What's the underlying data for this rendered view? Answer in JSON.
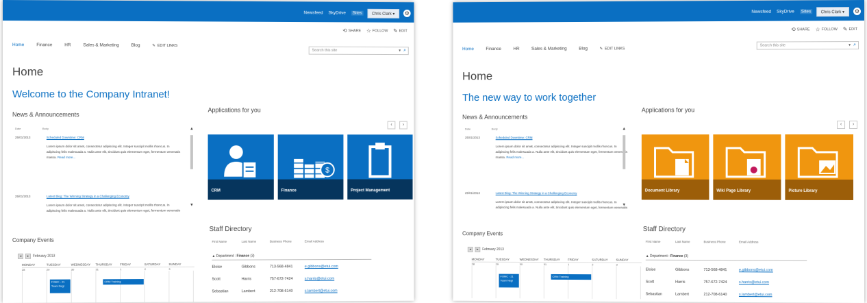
{
  "colors": {
    "accent": "#0a6fc2",
    "tile_blue": "#0a6fc2",
    "tile_blue_band": "#06355d",
    "tile_orange": "#f0960f",
    "tile_orange_band": "#9c5e09"
  },
  "suite": {
    "links": [
      "Newsfeed",
      "SkyDrive",
      "Sites"
    ],
    "user": "Chris Clark ▾"
  },
  "actions": {
    "share": "SHARE",
    "follow": "FOLLOW",
    "edit": "EDIT"
  },
  "nav": {
    "items": [
      "Home",
      "Finance",
      "HR",
      "Sales & Marketing",
      "Blog"
    ],
    "edit_links": "EDIT LINKS"
  },
  "search": {
    "placeholder": "Search this site"
  },
  "page_title": "Home",
  "news": {
    "heading": "News & Announcements",
    "col_date": "Date",
    "col_body": "Body",
    "items": [
      {
        "date": "25/01/2013",
        "title": "Scheduled Downtime: CRM",
        "body": "Lorem ipsum dolor sit amet, consectetur adipiscing elit. Integer suscipit mollis rhoncus. In adipiscing felis malesuada a. Nulla ante elit, tincidunt quis elementum eget, fermentum venenatis massa.",
        "more": "Read more..."
      },
      {
        "date": "25/01/2013",
        "title": "Latest Blog: The Winning Strategy in a Challenging Economy",
        "body": "Lorem ipsum dolor sit amet, consectetur adipiscing elit. Integer suscipit mollis rhoncus. In adipiscing felis malesuada a. Nulla ante elit, tincidunt quis elementum eget, fermentum venenatis",
        "more": ""
      }
    ]
  },
  "events": {
    "heading": "Company Events",
    "month": "February 2013",
    "days": [
      "MONDAY",
      "TUESDAY",
      "WEDNESDAY",
      "THURSDAY",
      "FRIDAY",
      "SATURDAY",
      "SUNDAY"
    ],
    "dates": [
      "28",
      "29",
      "30",
      "31",
      "1",
      "2",
      "3"
    ],
    "event_a": "FOMC - 21 Team Negl",
    "event_b": "CRM Training"
  },
  "apps": {
    "heading": "Applications for you",
    "prev": "‹",
    "next": "›"
  },
  "staff": {
    "heading": "Staff Directory",
    "cols": [
      "First Name",
      "Last Name",
      "Business Phone",
      "Email Address"
    ],
    "group_prefix": "▲ Department : ",
    "group_name": "Finance",
    "group_count": "(3)",
    "rows": [
      {
        "first": "Eloise",
        "last": "Gibbons",
        "phone": "713-568-4841",
        "email": "e.gibbons@etui.com"
      },
      {
        "first": "Scott",
        "last": "Harris",
        "phone": "757-672-7424",
        "email": "s.harris@etui.com"
      },
      {
        "first": "Sebastian",
        "last": "Lambert",
        "phone": "212-708-6140",
        "email": "s.lambert@etui.com"
      }
    ]
  },
  "shot1": {
    "welcome": "Welcome to the Company Intranet!",
    "tiles": [
      {
        "label": "CRM",
        "icon": "crm-user-icon"
      },
      {
        "label": "Finance",
        "icon": "coins-icon"
      },
      {
        "label": "Project Management",
        "icon": "clipboard-icon"
      }
    ]
  },
  "shot2": {
    "welcome": "The new way to work together",
    "tiles": [
      {
        "label": "Document Library",
        "icon": "folder-document-icon"
      },
      {
        "label": "Wiki Page Library",
        "icon": "folder-wiki-icon"
      },
      {
        "label": "Picture Library",
        "icon": "folder-picture-icon"
      }
    ]
  }
}
